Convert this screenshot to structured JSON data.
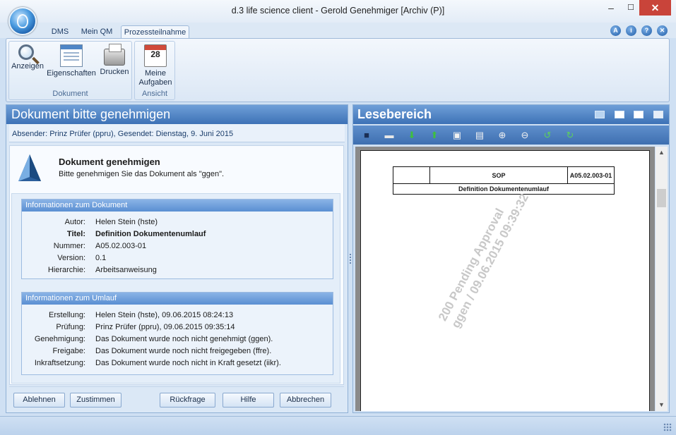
{
  "window": {
    "title": "d.3 life science client - Gerold Genehmiger [Archiv (P)]",
    "minimize": "–",
    "maximize": "☐",
    "close": "✕"
  },
  "ribbon": {
    "tabs": [
      "DMS",
      "Mein QM",
      "Prozessteilnahme"
    ],
    "help_icons": [
      "A",
      "i",
      "?",
      "✕"
    ],
    "groups": {
      "dokument": {
        "label": "Dokument",
        "buttons": [
          "Anzeigen",
          "Eigenschaften",
          "Drucken"
        ]
      },
      "ansicht": {
        "label": "Ansicht",
        "buttons": [
          "Meine Aufgaben"
        ],
        "calendar_day": "28"
      }
    }
  },
  "left_pane": {
    "title": "Dokument bitte genehmigen",
    "sender": "Absender: Prinz Prüfer (ppru), Gesendet: Dienstag, 9. Juni 2015",
    "task_title": "Dokument genehmigen",
    "task_subtitle": "Bitte genehmigen Sie das Dokument als \"ggen\".",
    "doc_info": {
      "header": "Informationen zum Dokument",
      "rows": [
        {
          "k": "Autor:",
          "v": "Helen Stein (hste)"
        },
        {
          "k": "Titel:",
          "v": "Definition Dokumentenumlauf"
        },
        {
          "k": "Nummer:",
          "v": "A05.02.003-01"
        },
        {
          "k": "Version:",
          "v": "0.1"
        },
        {
          "k": "Hierarchie:",
          "v": "Arbeitsanweisung"
        }
      ]
    },
    "circ_info": {
      "header": "Informationen zum Umlauf",
      "rows": [
        {
          "k": "Erstellung:",
          "v": "Helen Stein (hste), 09.06.2015 08:24:13"
        },
        {
          "k": "Prüfung:",
          "v": "Prinz Prüfer (ppru), 09.06.2015 09:35:14"
        },
        {
          "k": "Genehmigung:",
          "v": "Das Dokument wurde noch nicht genehmigt (ggen)."
        },
        {
          "k": "Freigabe:",
          "v": "Das Dokument wurde noch nicht freigegeben (ffre)."
        },
        {
          "k": "Inkraftsetzung:",
          "v": "Das Dokument wurde noch nicht in Kraft gesetzt (iikr)."
        }
      ]
    },
    "buttons": {
      "ablehnen": "Ablehnen",
      "zustimmen": "Zustimmen",
      "rueckfrage": "Rückfrage",
      "hilfe": "Hilfe",
      "abbrechen": "Abbrechen"
    }
  },
  "right_pane": {
    "title": "Lesebereich",
    "document": {
      "sop": "SOP",
      "number": "A05.02.003-01",
      "title": "Definition Dokumentenumlauf",
      "watermark_line1": "200 Pending Approval",
      "watermark_line2": "ggen / 09.06.2015 09:39:32"
    }
  },
  "colors": {
    "accent": "#3d72b6",
    "close": "#c9443a",
    "toolbar": "#3e6fb0"
  }
}
